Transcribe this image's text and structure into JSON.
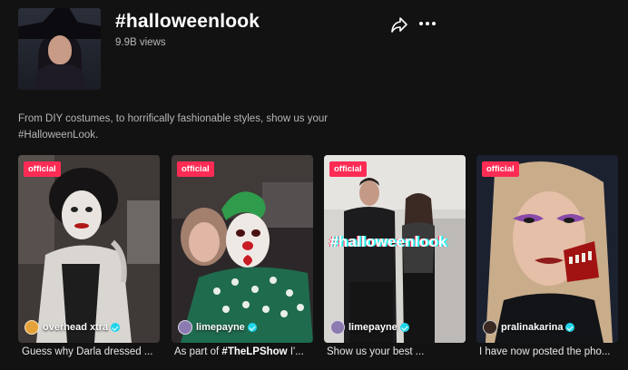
{
  "header": {
    "title": "#halloweenlook",
    "views": "9.9B views",
    "share_icon": "share-icon",
    "more_icon": "more-icon"
  },
  "description": "From DIY costumes, to horrifically fashionable styles, show us your #HalloweenLook.",
  "videos": [
    {
      "badge": "official",
      "author": "overhead xtra",
      "caption": "Guess why Darla dressed ...",
      "colors": {
        "bg": "#3d3634",
        "accent": "#e8e4df"
      }
    },
    {
      "badge": "official",
      "author": "limepayne",
      "caption_prefix": "As part of ",
      "caption_tag": "#TheLPShow",
      "caption_suffix": " I'...",
      "colors": {
        "bg": "#2f2a2c",
        "accent": "#3f9f5d"
      }
    },
    {
      "badge": "official",
      "author": "limepayne",
      "overlay_text": "#halloweenlook",
      "caption": "Show us your best ...",
      "colors": {
        "bg": "#cfcdca",
        "accent": "#1a1a1a"
      }
    },
    {
      "badge": "official",
      "author": "pralinakarina",
      "caption": "I have now posted the pho...",
      "colors": {
        "bg": "#1f2430",
        "accent": "#b71c1c"
      }
    }
  ]
}
